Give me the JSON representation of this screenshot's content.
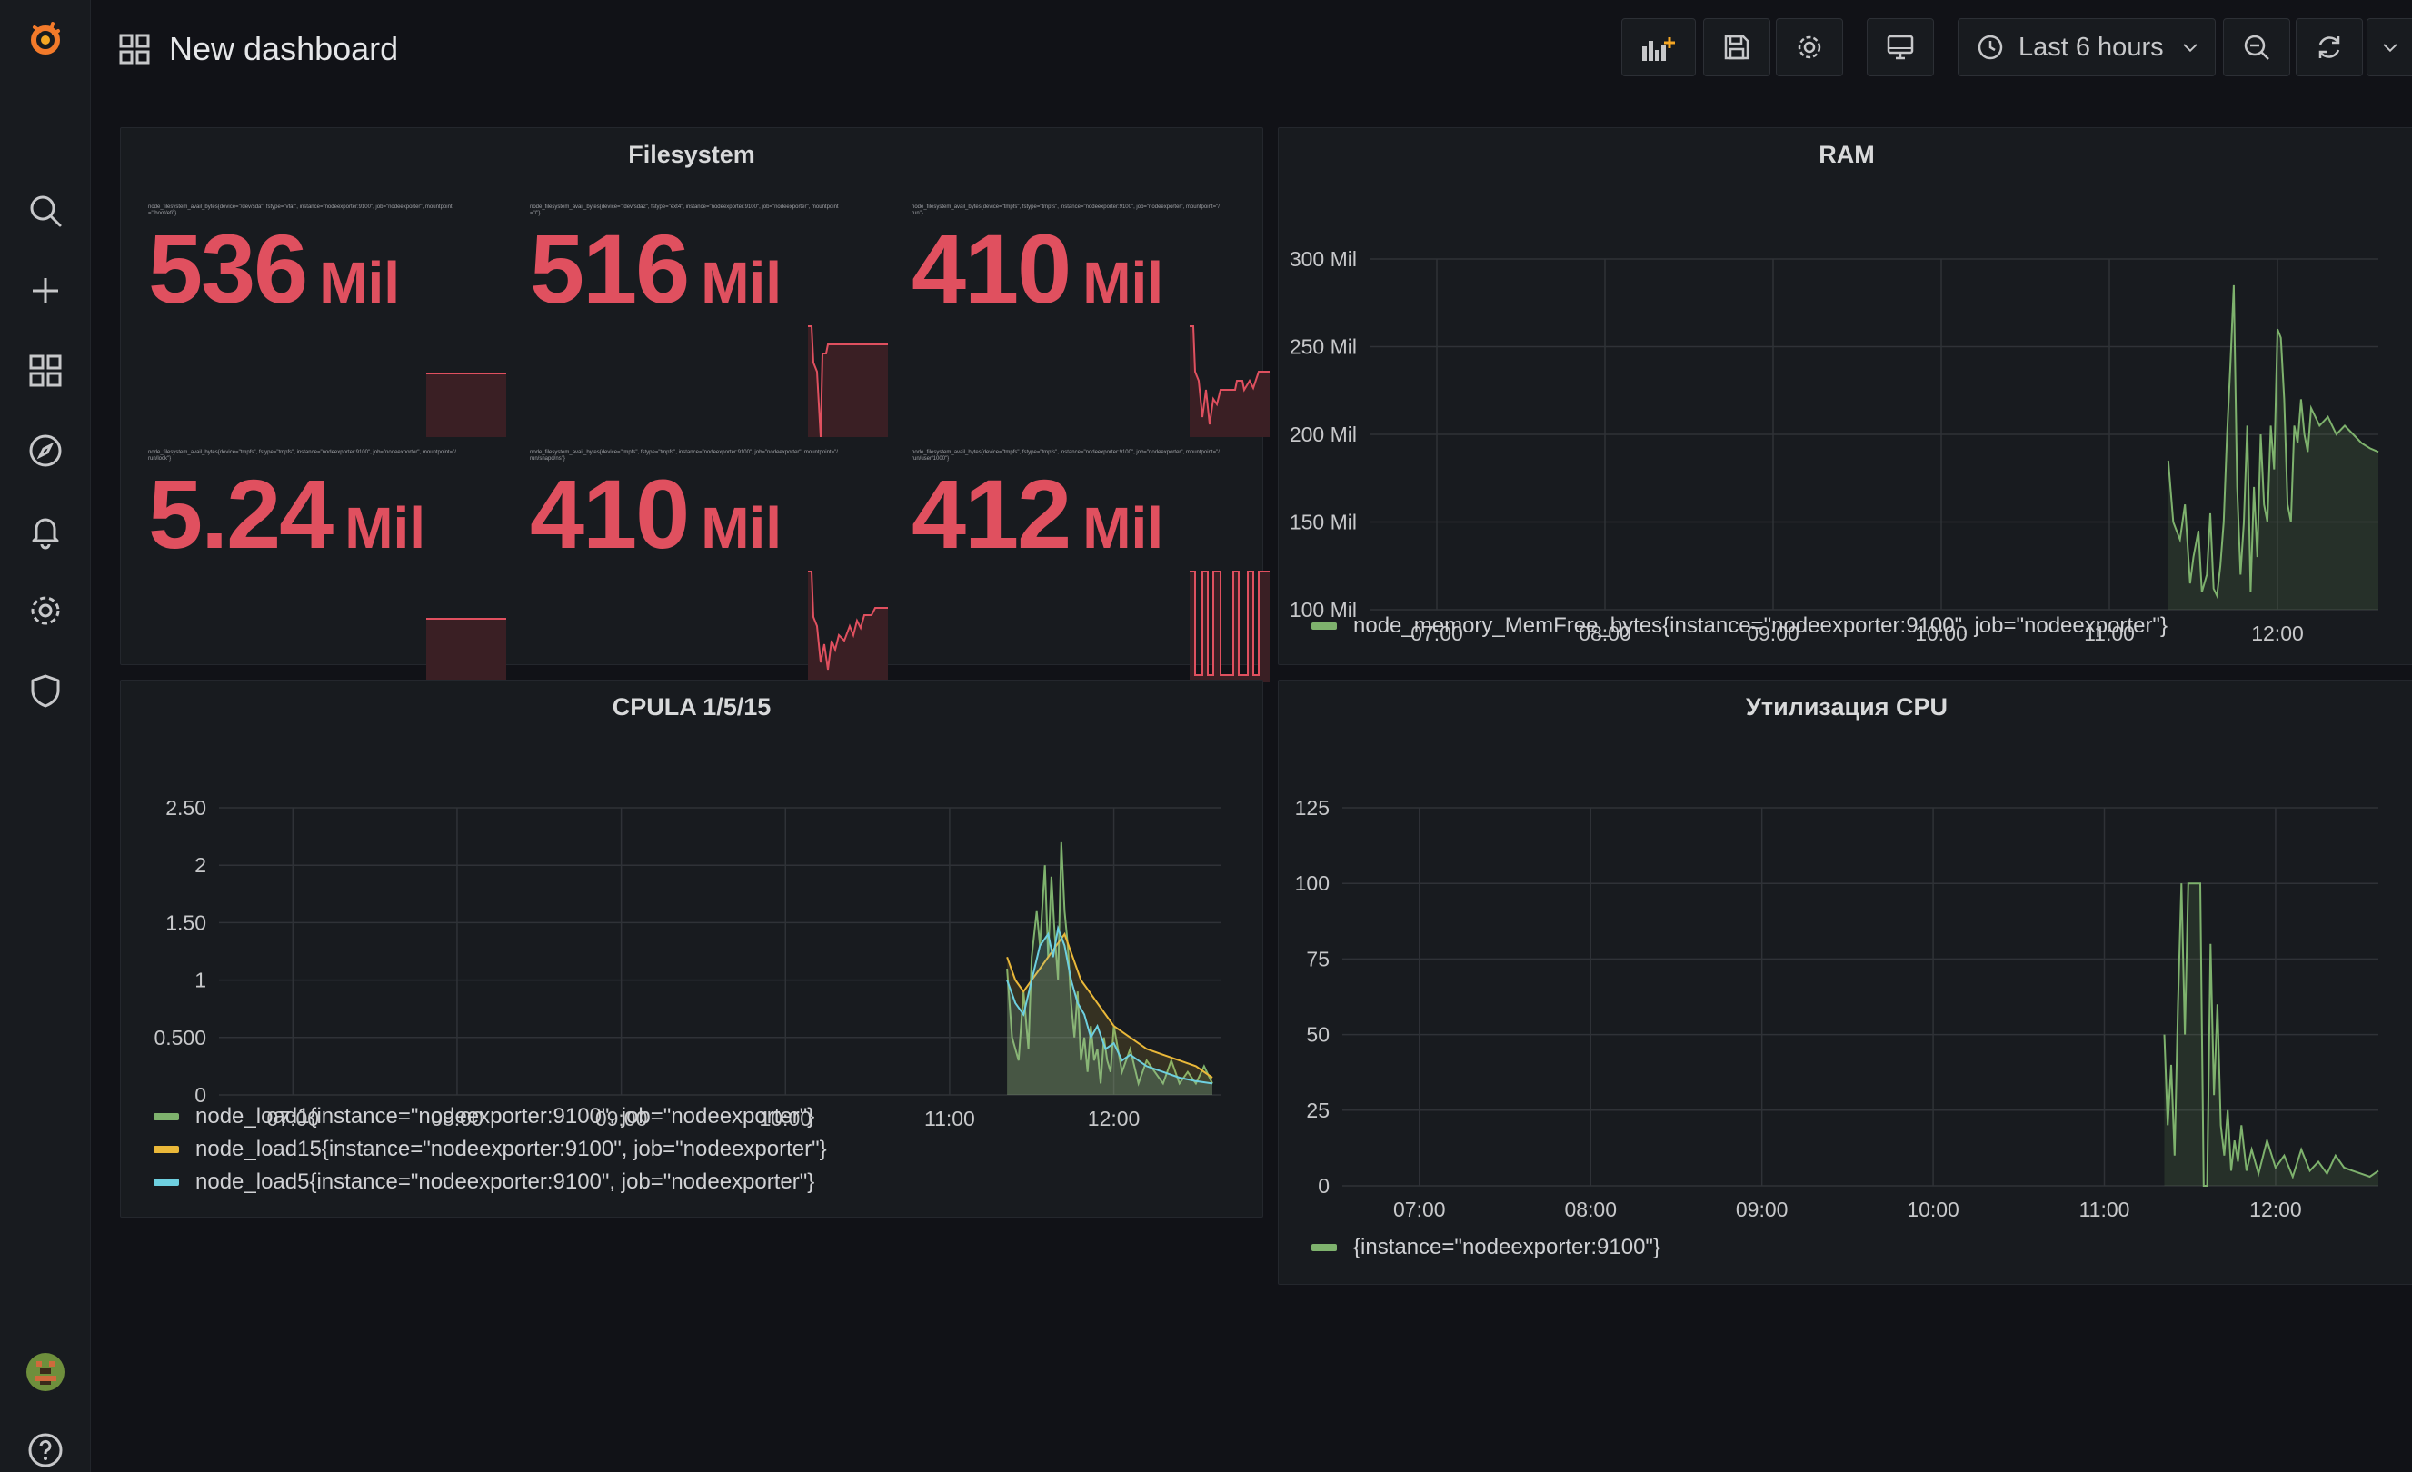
{
  "dashboard": {
    "title": "New dashboard"
  },
  "toolbar": {
    "time_range_label": "Last 6 hours",
    "icons": [
      "add-panel-icon",
      "save-icon",
      "gear-icon",
      "monitor-icon",
      "clock-icon",
      "chevron-down-icon",
      "zoom-out-icon",
      "refresh-icon",
      "chevron-down-icon"
    ]
  },
  "sidebar": {
    "icons": [
      "grafana-logo-icon",
      "search-icon",
      "plus-icon",
      "dashboards-icon",
      "explore-icon",
      "bell-icon",
      "gear-icon",
      "shield-icon",
      "avatar",
      "help-icon"
    ]
  },
  "colors": {
    "stat_red": "#e0505f",
    "green": "#7eb26d",
    "yellow": "#eab839",
    "blue": "#6ed0e0",
    "bg": "#111217",
    "panel": "#181b1f"
  },
  "filesystem": {
    "title": "Filesystem",
    "stats": [
      {
        "value": "536",
        "unit": "Mil",
        "legend": "node_filesystem_avail_bytes{device=\"/dev/sda\", fstype=\"vfat\", instance=\"nodeexporter:9100\", job=\"nodeexporter\", mountpoint=\"/boot/efi\"}"
      },
      {
        "value": "516",
        "unit": "Mil",
        "legend": "node_filesystem_avail_bytes{device=\"/dev/sda2\", fstype=\"ext4\", instance=\"nodeexporter:9100\", job=\"nodeexporter\", mountpoint=\"/\"}"
      },
      {
        "value": "410",
        "unit": "Mil",
        "legend": "node_filesystem_avail_bytes{device=\"tmpfs\", fstype=\"tmpfs\", instance=\"nodeexporter:9100\", job=\"nodeexporter\", mountpoint=\"/run\"}"
      },
      {
        "value": "5.24",
        "unit": "Mil",
        "legend": "node_filesystem_avail_bytes{device=\"tmpfs\", fstype=\"tmpfs\", instance=\"nodeexporter:9100\", job=\"nodeexporter\", mountpoint=\"/run/lock\"}"
      },
      {
        "value": "410",
        "unit": "Mil",
        "legend": "node_filesystem_avail_bytes{device=\"tmpfs\", fstype=\"tmpfs\", instance=\"nodeexporter:9100\", job=\"nodeexporter\", mountpoint=\"/run/snapd/ns\"}"
      },
      {
        "value": "412",
        "unit": "Mil",
        "legend": "node_filesystem_avail_bytes{device=\"tmpfs\", fstype=\"tmpfs\", instance=\"nodeexporter:9100\", job=\"nodeexporter\", mountpoint=\"/run/user/1000\"}"
      }
    ]
  },
  "ram": {
    "title": "RAM",
    "legend": [
      "node_memory_MemFree_bytes{instance=\"nodeexporter:9100\", job=\"nodeexporter\"}"
    ]
  },
  "cpula": {
    "title": "CPULA 1/5/15",
    "legend": [
      "node_load1{instance=\"nodeexporter:9100\", job=\"nodeexporter\"}",
      "node_load15{instance=\"nodeexporter:9100\", job=\"nodeexporter\"}",
      "node_load5{instance=\"nodeexporter:9100\", job=\"nodeexporter\"}"
    ]
  },
  "cpu": {
    "title": "Утилизация CPU",
    "legend": [
      "{instance=\"nodeexporter:9100\"}"
    ]
  },
  "chart_data": [
    {
      "type": "area",
      "title": "RAM",
      "x_ticks": [
        "07:00",
        "08:00",
        "09:00",
        "10:00",
        "11:00",
        "12:00"
      ],
      "y_ticks": [
        "100 Mil",
        "150 Mil",
        "200 Mil",
        "250 Mil",
        "300 Mil"
      ],
      "ylim": [
        100,
        300
      ],
      "xlim": [
        6.6,
        12.6
      ],
      "series": [
        {
          "name": "node_memory_MemFree_bytes{instance=\"nodeexporter:9100\", job=\"nodeexporter\"}",
          "color": "#7eb26d",
          "x": [
            11.35,
            11.38,
            11.42,
            11.45,
            11.48,
            11.5,
            11.53,
            11.55,
            11.58,
            11.6,
            11.62,
            11.64,
            11.66,
            11.68,
            11.7,
            11.72,
            11.74,
            11.76,
            11.78,
            11.8,
            11.82,
            11.84,
            11.86,
            11.88,
            11.9,
            11.92,
            11.94,
            11.96,
            11.98,
            12.0,
            12.02,
            12.04,
            12.06,
            12.08,
            12.1,
            12.12,
            12.14,
            12.16,
            12.18,
            12.2,
            12.25,
            12.3,
            12.35,
            12.4,
            12.45,
            12.5,
            12.55,
            12.6
          ],
          "y": [
            185,
            150,
            140,
            160,
            115,
            130,
            145,
            110,
            120,
            155,
            112,
            108,
            125,
            150,
            200,
            240,
            285,
            170,
            120,
            150,
            205,
            110,
            170,
            130,
            200,
            160,
            150,
            205,
            180,
            260,
            255,
            220,
            160,
            150,
            205,
            195,
            220,
            200,
            190,
            215,
            205,
            210,
            200,
            205,
            200,
            195,
            192,
            190
          ]
        }
      ]
    },
    {
      "type": "line",
      "title": "CPULA 1/5/15",
      "x_ticks": [
        "07:00",
        "08:00",
        "09:00",
        "10:00",
        "11:00",
        "12:00"
      ],
      "y_ticks": [
        "0",
        "0.500",
        "1",
        "1.50",
        "2",
        "2.50"
      ],
      "ylim": [
        0,
        2.5
      ],
      "xlim": [
        6.55,
        12.65
      ],
      "series": [
        {
          "name": "node_load1{instance=\"nodeexporter:9100\", job=\"nodeexporter\"}",
          "color": "#7eb26d",
          "x": [
            11.35,
            11.38,
            11.42,
            11.45,
            11.48,
            11.5,
            11.53,
            11.55,
            11.58,
            11.6,
            11.62,
            11.64,
            11.66,
            11.68,
            11.7,
            11.72,
            11.74,
            11.76,
            11.78,
            11.8,
            11.82,
            11.84,
            11.86,
            11.88,
            11.9,
            11.92,
            11.94,
            11.96,
            11.98,
            12.0,
            12.05,
            12.1,
            12.15,
            12.2,
            12.25,
            12.3,
            12.35,
            12.4,
            12.45,
            12.5,
            12.55,
            12.6
          ],
          "y": [
            1.1,
            0.5,
            0.3,
            0.9,
            0.4,
            1.2,
            1.6,
            1.3,
            2.0,
            1.2,
            1.9,
            1.4,
            1.0,
            2.2,
            1.6,
            1.3,
            0.8,
            0.5,
            0.9,
            0.3,
            0.5,
            0.2,
            0.6,
            0.3,
            0.4,
            0.1,
            0.5,
            0.3,
            0.2,
            0.6,
            0.2,
            0.4,
            0.1,
            0.3,
            0.2,
            0.1,
            0.3,
            0.1,
            0.2,
            0.1,
            0.25,
            0.1
          ]
        },
        {
          "name": "node_load15{instance=\"nodeexporter:9100\", job=\"nodeexporter\"}",
          "color": "#eab839",
          "x": [
            11.35,
            11.4,
            11.45,
            11.5,
            11.55,
            11.6,
            11.65,
            11.7,
            11.75,
            11.8,
            11.85,
            11.9,
            11.95,
            12.0,
            12.1,
            12.2,
            12.3,
            12.4,
            12.5,
            12.6
          ],
          "y": [
            1.2,
            1.0,
            0.9,
            1.0,
            1.1,
            1.2,
            1.3,
            1.4,
            1.2,
            1.0,
            0.9,
            0.8,
            0.7,
            0.6,
            0.5,
            0.4,
            0.35,
            0.3,
            0.25,
            0.15
          ]
        },
        {
          "name": "node_load5{instance=\"nodeexporter:9100\", job=\"nodeexporter\"}",
          "color": "#6ed0e0",
          "x": [
            11.35,
            11.4,
            11.45,
            11.5,
            11.55,
            11.6,
            11.63,
            11.66,
            11.7,
            11.74,
            11.78,
            11.82,
            11.86,
            11.9,
            11.95,
            12.0,
            12.05,
            12.1,
            12.2,
            12.3,
            12.4,
            12.5,
            12.6
          ],
          "y": [
            1.0,
            0.8,
            0.7,
            1.0,
            1.3,
            1.4,
            1.2,
            1.45,
            1.3,
            1.0,
            0.8,
            0.7,
            0.5,
            0.6,
            0.4,
            0.45,
            0.3,
            0.35,
            0.25,
            0.2,
            0.15,
            0.12,
            0.1
          ]
        }
      ]
    },
    {
      "type": "area",
      "title": "Утилизация CPU",
      "x_ticks": [
        "07:00",
        "08:00",
        "09:00",
        "10:00",
        "11:00",
        "12:00"
      ],
      "y_ticks": [
        "0",
        "25",
        "50",
        "75",
        "100",
        "125"
      ],
      "ylim": [
        0,
        125
      ],
      "xlim": [
        6.55,
        12.6
      ],
      "series": [
        {
          "name": "{instance=\"nodeexporter:9100\"}",
          "color": "#7eb26d",
          "x": [
            11.35,
            11.37,
            11.39,
            11.41,
            11.43,
            11.45,
            11.47,
            11.49,
            11.5,
            11.52,
            11.54,
            11.56,
            11.58,
            11.6,
            11.62,
            11.64,
            11.66,
            11.68,
            11.7,
            11.72,
            11.74,
            11.76,
            11.78,
            11.8,
            11.83,
            11.86,
            11.9,
            11.95,
            12.0,
            12.05,
            12.1,
            12.15,
            12.2,
            12.25,
            12.3,
            12.35,
            12.4,
            12.45,
            12.5,
            12.55,
            12.6
          ],
          "y": [
            50,
            20,
            40,
            10,
            60,
            100,
            50,
            100,
            100,
            100,
            100,
            100,
            0,
            0,
            80,
            30,
            60,
            20,
            10,
            25,
            5,
            15,
            8,
            20,
            5,
            12,
            4,
            15,
            6,
            10,
            3,
            12,
            5,
            8,
            4,
            10,
            6,
            5,
            4,
            3,
            5
          ]
        }
      ]
    }
  ]
}
